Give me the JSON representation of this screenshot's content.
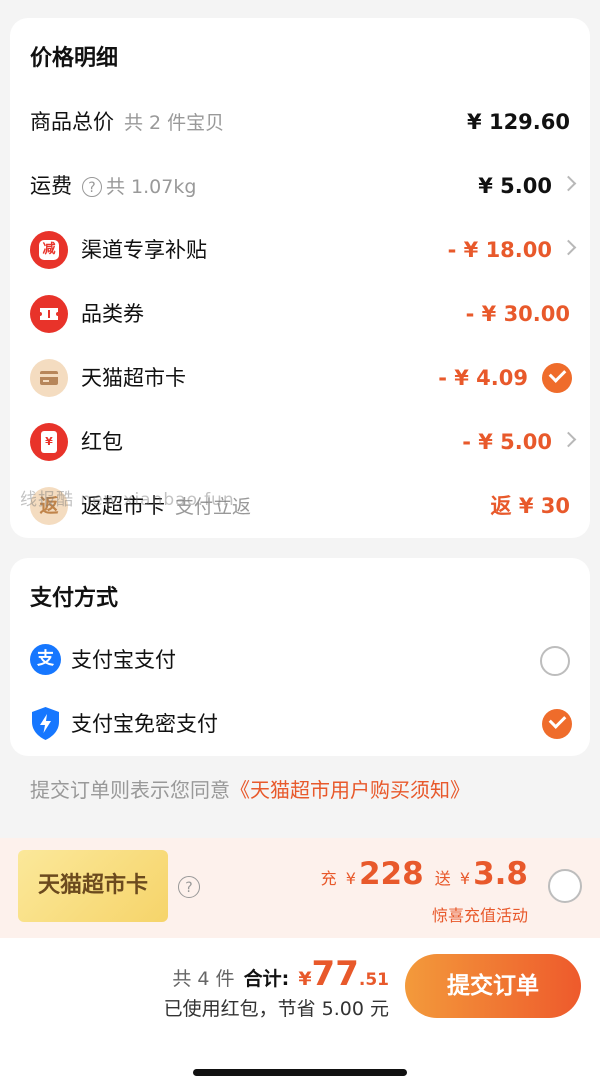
{
  "price_detail": {
    "title": "价格明细",
    "goods_total": {
      "label": "商品总价",
      "sub": "共 2 件宝贝",
      "value": "¥ 129.60"
    },
    "shipping": {
      "label": "运费",
      "help_icon": "question-icon",
      "sub": "共 1.07kg",
      "value": "¥ 5.00"
    },
    "channel_subsidy": {
      "icon_text": "减",
      "label": "渠道专享补贴",
      "value": "- ¥ 18.00"
    },
    "category_coupon": {
      "label": "品类券",
      "value": "- ¥ 30.00"
    },
    "tmall_card": {
      "label": "天猫超市卡",
      "value": "- ¥ 4.09"
    },
    "red_packet": {
      "label": "红包",
      "value": "- ¥ 5.00"
    },
    "return_card": {
      "icon_text": "返",
      "label": "返超市卡",
      "sub": "支付立返",
      "value": "返 ¥ 30"
    }
  },
  "watermark": "线报酷  new.xianbao.fun",
  "payment": {
    "title": "支付方式",
    "options": [
      {
        "icon_text": "支",
        "label": "支付宝支付",
        "selected": false
      },
      {
        "label": "支付宝免密支付",
        "selected": true
      }
    ]
  },
  "agreement": {
    "prefix": "提交订单则表示您同意",
    "link": "《天猫超市用户购买须知》"
  },
  "recharge": {
    "card_label": "天猫超市卡",
    "charge_prefix": "充",
    "charge_currency": "¥",
    "charge_amount": "228",
    "gift_prefix": "送",
    "gift_currency": "¥",
    "gift_amount": "3.8",
    "activity": "惊喜充值活动",
    "selected": false
  },
  "footer": {
    "count": "共 4 件",
    "total_label": "合计:",
    "currency": "¥",
    "total_int": "77",
    "total_dec": ".51",
    "savings": "已使用红包，节省 5.00 元",
    "submit": "提交订单"
  },
  "colors": {
    "accent": "#ef6c2b",
    "price_red": "#e8592b",
    "badge_red": "#e8332a",
    "alipay_blue": "#1677ff"
  }
}
